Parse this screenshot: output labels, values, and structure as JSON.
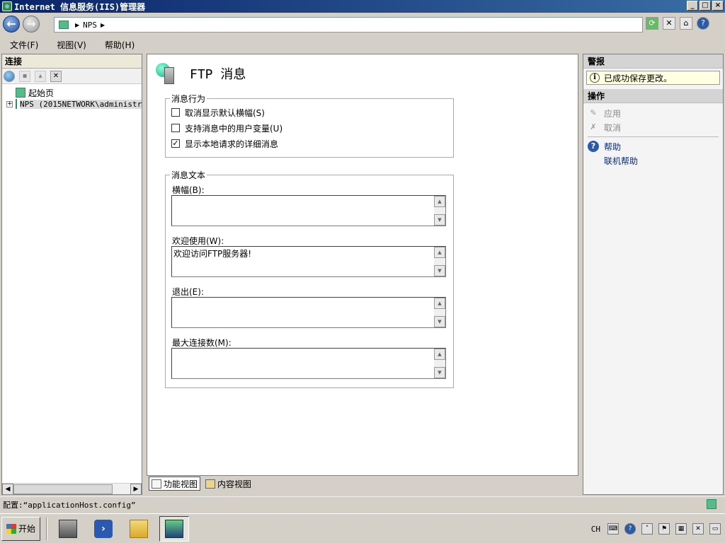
{
  "window": {
    "title": "Internet 信息服务(IIS)管理器",
    "buttons": {
      "minimize": "_",
      "maximize": "□",
      "close": "×"
    }
  },
  "address": {
    "crumbs": [
      "NPS"
    ]
  },
  "menu": [
    {
      "label": "文件(F)"
    },
    {
      "label": "视图(V)"
    },
    {
      "label": "帮助(H)"
    }
  ],
  "connections": {
    "header": "连接",
    "tree": [
      {
        "label": "起始页",
        "expandable": false
      },
      {
        "label": "NPS (2015NETWORK\\administr",
        "expandable": true,
        "expander": "+"
      }
    ]
  },
  "page": {
    "title": "FTP 消息",
    "behavior": {
      "legend": "消息行为",
      "options": [
        {
          "label": "取消显示默认横幅(S)",
          "checked": false
        },
        {
          "label": "支持消息中的用户变量(U)",
          "checked": false
        },
        {
          "label": "显示本地请求的详细消息",
          "checked": true
        }
      ]
    },
    "text": {
      "legend": "消息文本",
      "fields": [
        {
          "label": "横幅(B):",
          "value": ""
        },
        {
          "label": "欢迎使用(W):",
          "value": "欢迎访问FTP服务器!"
        },
        {
          "label": "退出(E):",
          "value": ""
        },
        {
          "label": "最大连接数(M):",
          "value": ""
        }
      ]
    }
  },
  "view_tabs": [
    {
      "label": "功能视图",
      "active": true
    },
    {
      "label": "内容视图",
      "active": false
    }
  ],
  "alerts": {
    "header": "警报",
    "message": "已成功保存更改。"
  },
  "actions": {
    "header": "操作",
    "items": {
      "apply": "应用",
      "cancel": "取消",
      "help": "帮助",
      "online_help": "联机帮助"
    }
  },
  "status": {
    "text": "配置:“applicationHost.config”"
  },
  "taskbar": {
    "start": "开始",
    "lang": "CH"
  }
}
